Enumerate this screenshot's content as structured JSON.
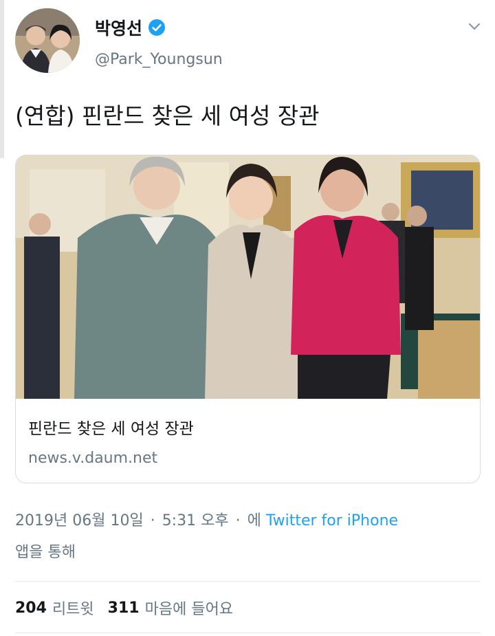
{
  "user": {
    "display_name": "박영선",
    "handle": "@Park_Youngsun"
  },
  "tweet": {
    "text": "(연합) 핀란드 찾은 세 여성 장관"
  },
  "card": {
    "title": "핀란드 찾은 세 여성 장관",
    "domain": "news.v.daum.net"
  },
  "meta": {
    "date": "2019년 06월 10일",
    "time": "5:31 오후",
    "via_prefix": "에",
    "source": "Twitter for iPhone",
    "via_suffix": "앱을 통해"
  },
  "stats": {
    "retweets_count": "204",
    "retweets_label": "리트윗",
    "likes_count": "311",
    "likes_label": "마음에 들어요"
  },
  "colors": {
    "accent": "#1da1f2",
    "secondary_text": "#657786",
    "primary_text": "#14171a",
    "divider": "#e1e8ed"
  },
  "icons": {
    "verified": "verified-badge-icon",
    "caret": "chevron-down-icon"
  }
}
